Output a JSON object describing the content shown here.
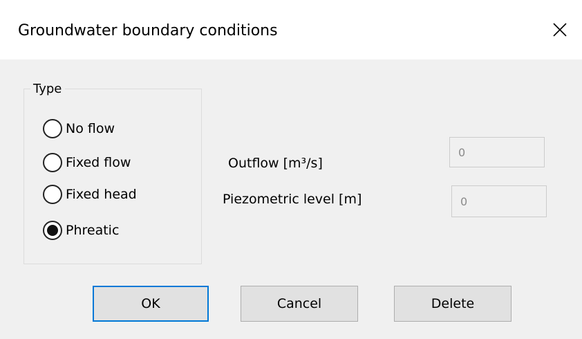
{
  "window": {
    "title": "Groundwater boundary conditions",
    "close_icon": "close-icon"
  },
  "type_group": {
    "label": "Type",
    "options": [
      {
        "label": "No flow",
        "checked": false
      },
      {
        "label": "Fixed flow",
        "checked": false
      },
      {
        "label": "Fixed head",
        "checked": false
      },
      {
        "label": "Phreatic",
        "checked": true
      }
    ]
  },
  "fields": {
    "outflow": {
      "label": "Outflow [m³/s]",
      "value": "0",
      "disabled": true
    },
    "piezometric": {
      "label": "Piezometric level [m]",
      "value": "0",
      "disabled": true
    }
  },
  "buttons": {
    "ok": "OK",
    "cancel": "Cancel",
    "delete": "Delete"
  },
  "colors": {
    "accent": "#0078d7",
    "background": "#f0f0f0",
    "titlebar": "#ffffff"
  }
}
